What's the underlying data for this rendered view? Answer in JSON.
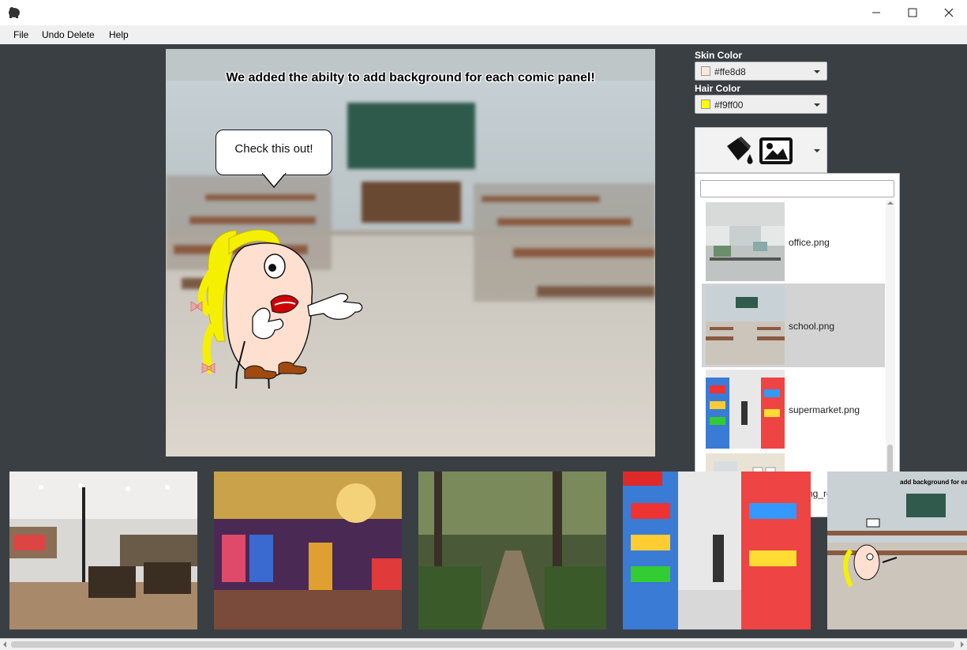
{
  "window": {
    "minimize_glyph": "—",
    "maximize_glyph": "☐",
    "close_glyph": "✕"
  },
  "menu": {
    "items": [
      "File",
      "Undo Delete",
      "Help"
    ]
  },
  "panel": {
    "title": "We added the abilty to add background for each comic panel!",
    "speech_bubble": "Check this out!",
    "background": "school.png"
  },
  "controls": {
    "skin_label": "Skin Color",
    "skin_value": "#ffe8d8",
    "skin_swatch": "#ffe8d8",
    "hair_label": "Hair Color",
    "hair_value": "#f9ff00",
    "hair_swatch": "#f9ff00",
    "background_button_icons": [
      "paint-bucket-icon",
      "image-icon"
    ]
  },
  "background_dropdown": {
    "search_value": "",
    "items": [
      {
        "name": "office.png",
        "selected": false
      },
      {
        "name": "school.png",
        "selected": true
      },
      {
        "name": "supermarket.png",
        "selected": false
      },
      {
        "name": "waiting_room.png",
        "selected": false
      }
    ]
  },
  "filmstrip": {
    "thumbnails": [
      "restaurant",
      "casino",
      "forest",
      "supermarket",
      "school panel"
    ],
    "partial_caption": "add background for each"
  }
}
